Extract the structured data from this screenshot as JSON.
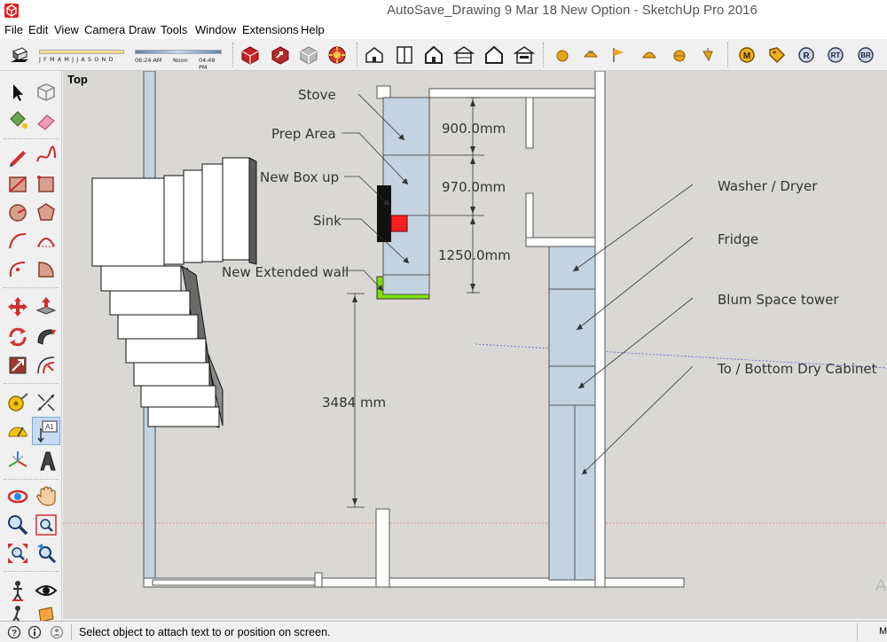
{
  "window": {
    "title": "AutoSave_Drawing 9 Mar 18 New Option - SketchUp Pro 2016"
  },
  "menu": [
    "File",
    "Edit",
    "View",
    "Camera",
    "Draw",
    "Tools",
    "Window",
    "Extensions",
    "Help"
  ],
  "shadow": {
    "months": "J F M A M J J A S O N D",
    "time_start": "06:24 AM",
    "time_noon": "Noon",
    "time_end": "04:49 PM"
  },
  "toolbar": {
    "extension_buttons": [
      "M",
      "R",
      "RT",
      "BR"
    ]
  },
  "viewport": {
    "scene": "Top",
    "labels": {
      "stove": "Stove",
      "prep_area": "Prep Area",
      "new_box_up": "New Box up",
      "sink": "Sink",
      "new_extended_wall": "New Extended wall",
      "washer_dryer": "Washer / Dryer",
      "fridge": "Fridge",
      "blum_space_tower": "Blum Space tower",
      "dry_cabinet": "To / Bottom Dry Cabinet"
    },
    "dimensions": {
      "d1": "900.0mm",
      "d2": "970.0mm",
      "d3": "1250.0mm",
      "d4": "3484 mm"
    },
    "watermark": "A"
  },
  "status": {
    "text": "Select object to attach text to or position on screen.",
    "measurements_label": "M"
  },
  "colors": {
    "viewport_bg": "#d9d8d4",
    "cabinet_fill": "#c3d3e1",
    "wall_fill": "#ffffff",
    "green_wall": "#7ee000",
    "red_box": "#ff2020",
    "black_box": "#111111"
  }
}
